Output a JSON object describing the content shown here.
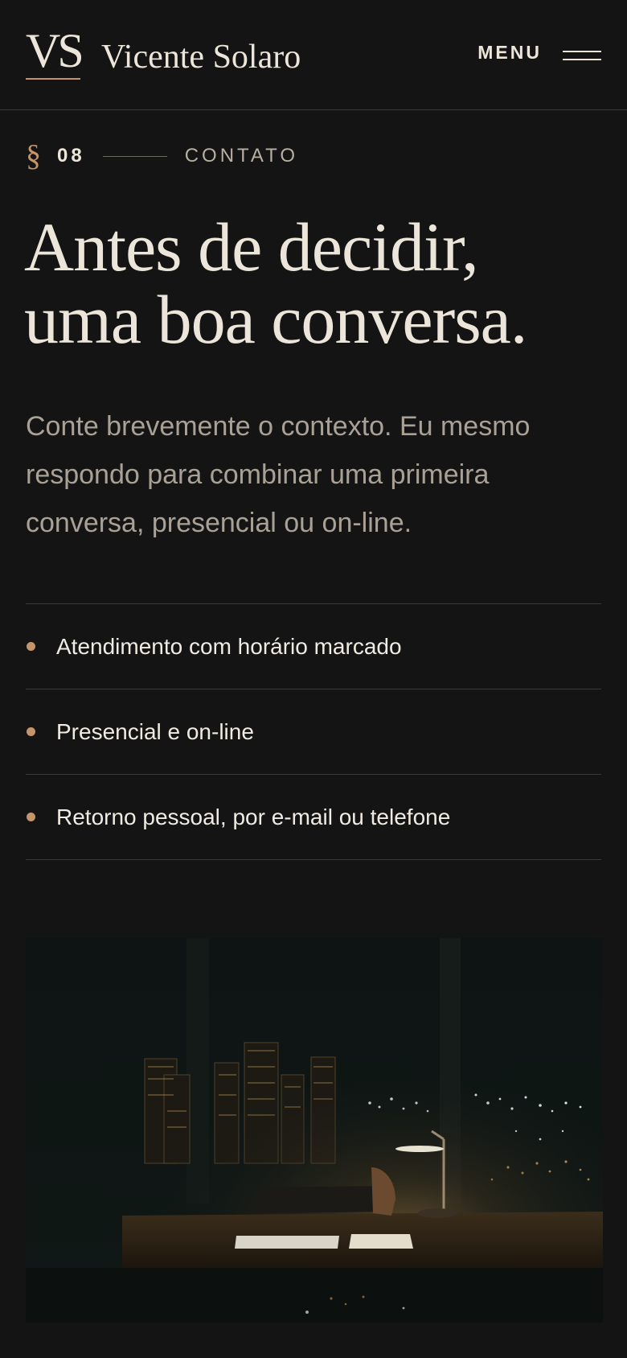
{
  "header": {
    "monogram": "VS",
    "name": "Vicente Solaro",
    "menu_label": "MENU"
  },
  "section": {
    "mark": "§",
    "number": "08",
    "name": "CONTATO"
  },
  "headline": {
    "line1": "Antes de decidir,",
    "line2": "uma boa conversa."
  },
  "intro": "Conte brevemente o contexto. Eu mesmo respondo para combinar uma primeira conversa, presencial ou on-line.",
  "features": [
    {
      "label": "Atendimento com horário marcado"
    },
    {
      "label": "Presencial e on-line"
    },
    {
      "label": "Retorno pessoal, por e-mail ou telefone"
    }
  ],
  "colors": {
    "background": "#141414",
    "accent": "#c4956a",
    "text": "#ece6da",
    "muted": "#a9a196"
  },
  "icons": [
    "hamburger-menu-icon",
    "bullet-dot-icon"
  ]
}
